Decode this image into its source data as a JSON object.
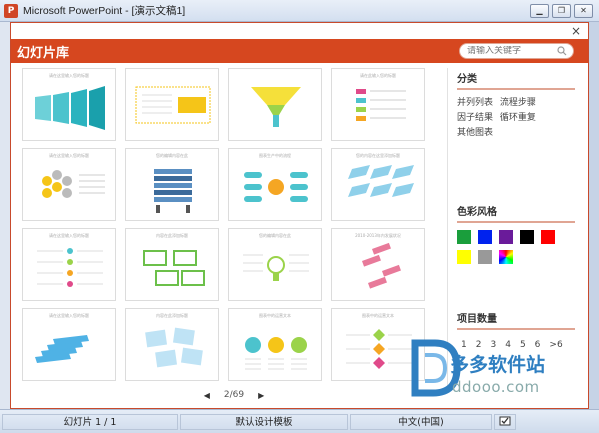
{
  "window": {
    "title": "Microsoft PowerPoint - [演示文稿1]",
    "app_icon": "P"
  },
  "dialog": {
    "title": "幻灯片库",
    "close_glyph": "×",
    "search_placeholder": "请输入关键字"
  },
  "thumbnails": [
    {
      "caption": "请在这里输入您的标题",
      "kind": "arrow-steps",
      "inner_label": "标题"
    },
    {
      "caption": "",
      "kind": "timeline-box",
      "inner_label": "请在此输入标题"
    },
    {
      "caption": "",
      "kind": "funnel",
      "inner_label": ""
    },
    {
      "caption": "请在此输入您的标题",
      "kind": "list",
      "inner_label": ""
    },
    {
      "caption": "请在这里输入您的标题",
      "kind": "hexagons",
      "inner_label": ""
    },
    {
      "caption": "您的编辑内容在此",
      "kind": "shelves",
      "inner_label": ""
    },
    {
      "caption": "图表生产中的流程",
      "kind": "bubbles",
      "inner_label": ""
    },
    {
      "caption": "您的内容在这里添加标题",
      "kind": "parallelograms",
      "inner_label": "标题"
    },
    {
      "caption": "请在这里输入您的标题",
      "kind": "dot-steps",
      "inner_label": ""
    },
    {
      "caption": "内容在此添加标题",
      "kind": "notes",
      "inner_label": ""
    },
    {
      "caption": "您的编辑内容在此",
      "kind": "lightbulb",
      "inner_label": ""
    },
    {
      "caption": "2010-2013年内发展状况",
      "kind": "tags",
      "inner_label": ""
    },
    {
      "caption": "请在这里输入您的标题",
      "kind": "books",
      "inner_label": ""
    },
    {
      "caption": "内容在此添加标题",
      "kind": "sticky",
      "inner_label": ""
    },
    {
      "caption": "图表中的运营文本",
      "kind": "circles",
      "inner_label": ""
    },
    {
      "caption": "图表中的运营文本",
      "kind": "diamonds",
      "inner_label": ""
    }
  ],
  "pager": {
    "prev": "◀",
    "label": "2/69",
    "next": "▶"
  },
  "panel": {
    "category_title": "分类",
    "categories": [
      "并列列表",
      "流程步骤",
      "因子结果",
      "循环重复",
      "其他图表"
    ],
    "color_title": "色彩风格",
    "colors": [
      "#1a9e3c",
      "#0022ee",
      "#6a1b9a",
      "#000000",
      "#ff0000",
      "#ffff00",
      "#999999",
      "multi"
    ],
    "count_title": "项目数量",
    "counts": [
      "1",
      "2",
      "3",
      "4",
      "5",
      "6",
      ">6"
    ]
  },
  "statusbar": {
    "slide": "幻灯片 1 / 1",
    "template": "默认设计模板",
    "language": "中文(中国)"
  },
  "watermark": {
    "name": "多多软件站",
    "url": "ddooo.com"
  }
}
